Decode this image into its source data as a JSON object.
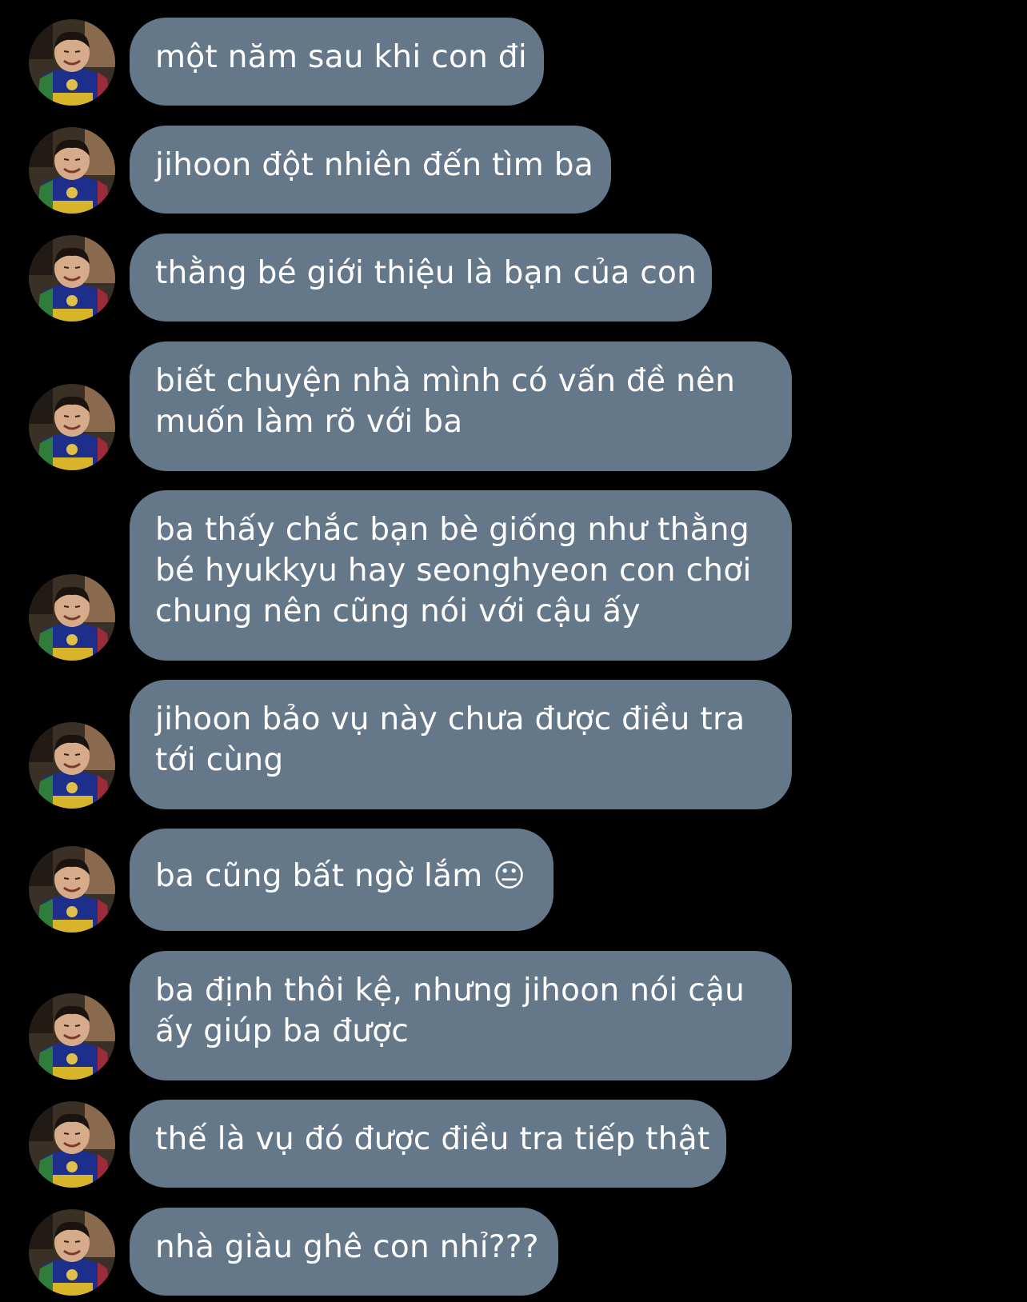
{
  "messages": [
    {
      "lines": [
        "một năm sau khi con đi"
      ]
    },
    {
      "lines": [
        "jihoon đột nhiên đến tìm ba"
      ]
    },
    {
      "lines": [
        "thằng bé giới thiệu là bạn của con"
      ]
    },
    {
      "lines": [
        "biết chuyện nhà mình có vấn đề nên",
        "muốn làm rõ với ba"
      ]
    },
    {
      "lines": [
        "ba thấy chắc bạn bè giống như thằng",
        "bé hyukkyu hay seonghyeon con chơi",
        "chung nên cũng nói với cậu ấy"
      ]
    },
    {
      "lines": [
        "jihoon bảo vụ này chưa được điều tra",
        "tới cùng"
      ]
    },
    {
      "lines": [
        "ba cũng bất ngờ lắm 😐"
      ]
    },
    {
      "lines": [
        "ba định thôi kệ, nhưng jihoon nói cậu",
        "ấy giúp ba được"
      ]
    },
    {
      "lines": [
        "thế là vụ đó được điều tra tiếp thật"
      ]
    },
    {
      "lines": [
        "nhà giàu ghê con nhỉ???"
      ]
    }
  ],
  "avatar": {
    "icon": "child-photo-avatar-icon"
  },
  "colors": {
    "background": "#000000",
    "bubble": "#64788a",
    "text": "#ffffff"
  }
}
